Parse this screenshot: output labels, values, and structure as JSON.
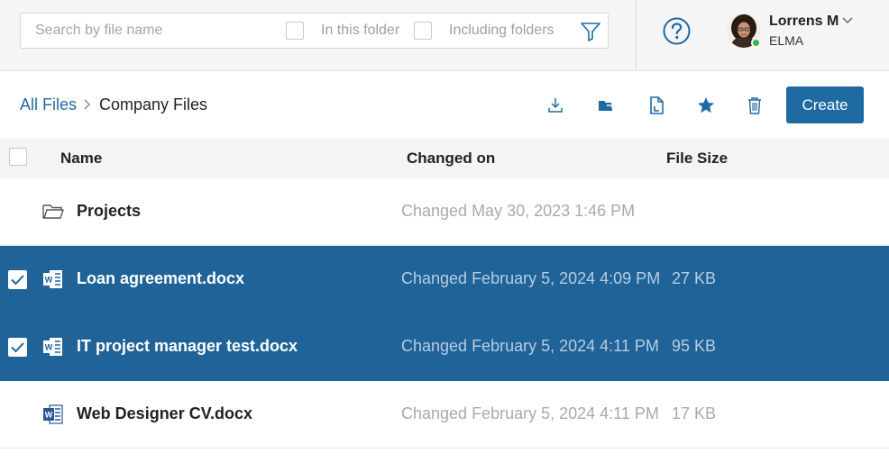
{
  "search": {
    "placeholder": "Search by file name",
    "option_in_folder": "In this folder",
    "option_include_folders": "Including folders"
  },
  "user": {
    "name": "Lorrens M",
    "org": "ELMA",
    "status_color": "#3bb34a"
  },
  "breadcrumb": {
    "root": "All Files",
    "current": "Company Files"
  },
  "toolbar": {
    "icons": [
      "download-icon",
      "move-folder-icon",
      "document-icon",
      "star-icon",
      "trash-icon"
    ],
    "create_label": "Create"
  },
  "table": {
    "columns": {
      "name": "Name",
      "changed": "Changed on",
      "size": "File Size"
    },
    "rows": [
      {
        "type": "folder",
        "name": "Projects",
        "changed": "Changed May 30, 2023 1:46 PM",
        "size": "",
        "selected": false
      },
      {
        "type": "docx",
        "name": "Loan agreement.docx",
        "changed": "Changed February 5, 2024 4:09 PM",
        "size": "27 KB",
        "selected": true
      },
      {
        "type": "docx",
        "name": "IT project manager test.docx",
        "changed": "Changed February 5, 2024 4:11 PM",
        "size": "95 KB",
        "selected": true
      },
      {
        "type": "docx",
        "name": "Web Designer CV.docx",
        "changed": "Changed February 5, 2024 4:11 PM",
        "size": "17 KB",
        "selected": false
      }
    ]
  },
  "colors": {
    "accent": "#1f6aa3",
    "selected_row": "#1f6399"
  }
}
